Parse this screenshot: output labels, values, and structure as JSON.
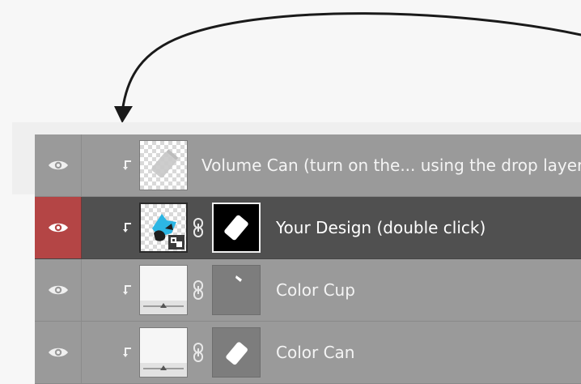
{
  "layers_panel": {
    "layers": [
      {
        "name": "Volume Can (turn on the... using the drop layer)",
        "selected": false,
        "visible": true,
        "clipped": true,
        "thumbnail": "transparent-can-thumbnail",
        "has_mask": false
      },
      {
        "name": "Your Design (double click)",
        "selected": true,
        "visible": true,
        "clipped": true,
        "thumbnail": "smart-object-design-thumbnail",
        "has_mask": true,
        "mask": "black-mask-with-white-can"
      },
      {
        "name": "Color Cup",
        "selected": false,
        "visible": true,
        "clipped": true,
        "thumbnail": "solid-fill-thumbnail",
        "has_mask": true,
        "mask": "gray-mask-with-cup-edge"
      },
      {
        "name": "Color Can",
        "selected": false,
        "visible": true,
        "clipped": true,
        "thumbnail": "solid-fill-thumbnail",
        "has_mask": true,
        "mask": "gray-mask-with-white-can"
      }
    ]
  },
  "colors": {
    "panel_bg": "#9a9a9a",
    "selected_row_bg": "#505050",
    "selected_eye_bg": "#b44545",
    "layer_text": "#f4f4f4",
    "annotation_arrow": "#1a1a1a"
  }
}
